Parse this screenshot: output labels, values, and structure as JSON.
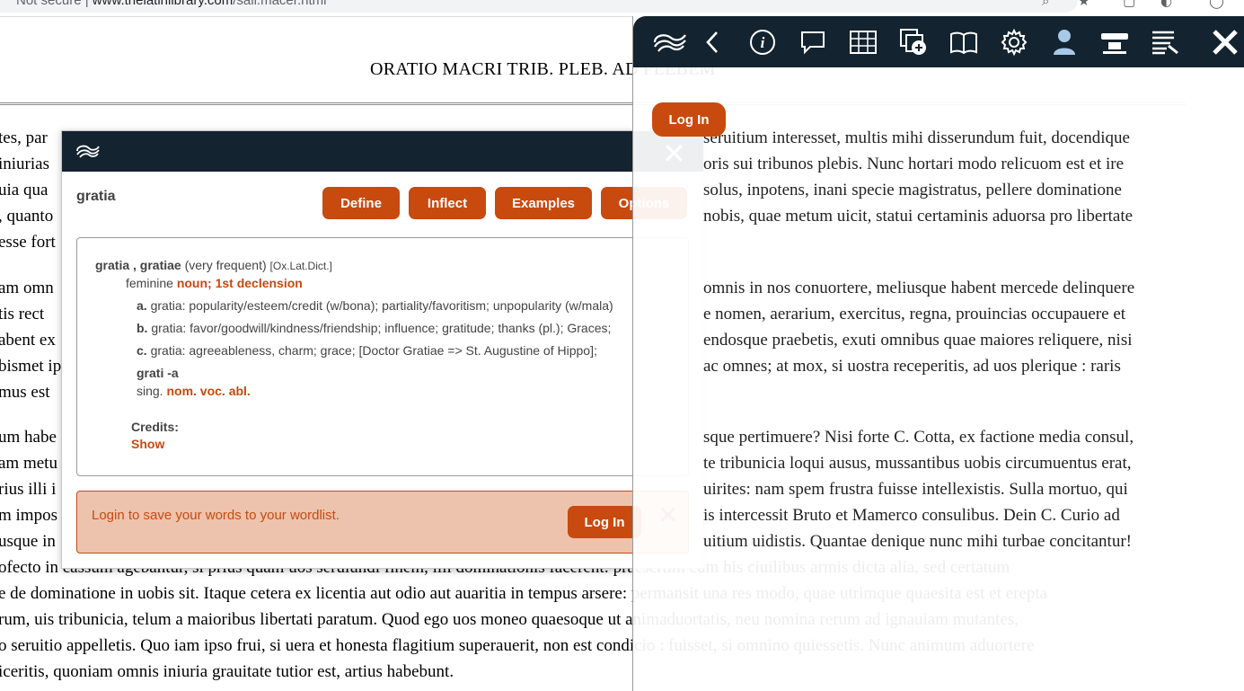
{
  "browser": {
    "security_label": "Not secure",
    "separator": "|",
    "url_domain": "www.thelatinlibrary.com",
    "url_path": "/sall.macer.html"
  },
  "page": {
    "title": "ORATIO MACRI TRIB. PLEB. AD PLEBEM",
    "left_fragments": [
      "tes, par",
      "iniurias",
      "uia qua",
      ", quanto",
      "esse fort",
      "am omn",
      "tis rect",
      "abent ex",
      "bismet ip",
      "mus est",
      "um habe",
      "am metu",
      "rius illi i",
      "m impos",
      "usque in"
    ],
    "bottom_lines": [
      "ofecto in cassum agebantur, si prius quam uos seruiundi finem, illi dominationis facerent: praesertim cum his ciuilibus armis dicta alia, sed certatum",
      "e de dominatione in uobis sit. Itaque cetera ex licentia aut odio aut auaritia in tempus arsere: permansit una res modo, quae utrimque quaesita est et erepta",
      "rum, uis tribunicia, telum a maioribus libertati paratum. Quod ego uos moneo quaesoque ut animaduortatis, neu nomina rerum ad ignauiam mutantes,",
      "o seruitio appelletis. Quo iam ipso frui, si uera et honesta flagitium superauerit, non est condicio : fuisset, si omnino quiessetis. Nunc animum aduortere",
      "iceritis, quoniam omnis iniuria grauitate tutior est, artius habebunt."
    ],
    "right_lines": [
      "seruitium interesset, multis mihi disserundum fuit, docendique",
      "oris sui tribunos plebis. Nunc hortari modo relicuom est et ire",
      "solus, inpotens, inani specie magistratus, pellere dominatione",
      "nobis, quae metum uicit, statui certaminis aduorsa pro libertate",
      "omnis in nos conuortere, meliusque habent mercede delinquere",
      "e nomen, aerarium, exercitus, regna, prouincias occupauere et",
      "endosque praebetis, exuti omnibus quae maiores reliquere, nisi",
      "ac omnes; at mox, si uostra receperitis, ad uos plerique : raris",
      "sque pertimuere? Nisi forte C. Cotta, ex factione media consul,",
      "te tribunicia loqui ausus, mussantibus uobis circumuentus erat,",
      "uirites: nam spem frustra fuisse intellexistis. Sulla mortuo, qui",
      "is intercessit Bruto et Mamerco consulibus. Dein C. Curio ad",
      "uitium uidistis. Quantae denique nunc mihi turbae concitantur!"
    ]
  },
  "popup": {
    "close_glyph": "✕",
    "lemma": "gratia",
    "buttons": {
      "define": "Define",
      "inflect": "Inflect",
      "examples": "Examples",
      "options": "Options"
    },
    "entry_headword": "gratia , gratiae",
    "entry_frequency": "(very frequent)",
    "entry_source": "[Ox.Lat.Dict.]",
    "gender": "feminine",
    "pos": "noun; 1st declension",
    "senses": [
      {
        "letter": "a.",
        "text": "gratia: popularity/esteem/credit (w/bona); partiality/favoritism; unpopularity (w/mala)"
      },
      {
        "letter": "b.",
        "text": "gratia: favor/goodwill/kindness/friendship; influence; gratitude; thanks (pl.); Graces;"
      },
      {
        "letter": "c.",
        "text": "gratia: agreeableness, charm; grace; [Doctor Gratiae => St. Augustine of Hippo];"
      }
    ],
    "stem": "grati -a",
    "inflection_num": "sing.",
    "inflection_cases": "nom. voc. abl.",
    "credits_label": "Credits:",
    "credits_show": "Show",
    "login_message": "Login to save your words to your wordlist.",
    "login_button": "Log In",
    "login_close": "✕"
  },
  "panel": {
    "close_glyph": "✕",
    "login_button": "Log In"
  },
  "colors": {
    "accent": "#c84a0e",
    "toolbar": "#13232f",
    "login_bg": "#edc3ad"
  }
}
